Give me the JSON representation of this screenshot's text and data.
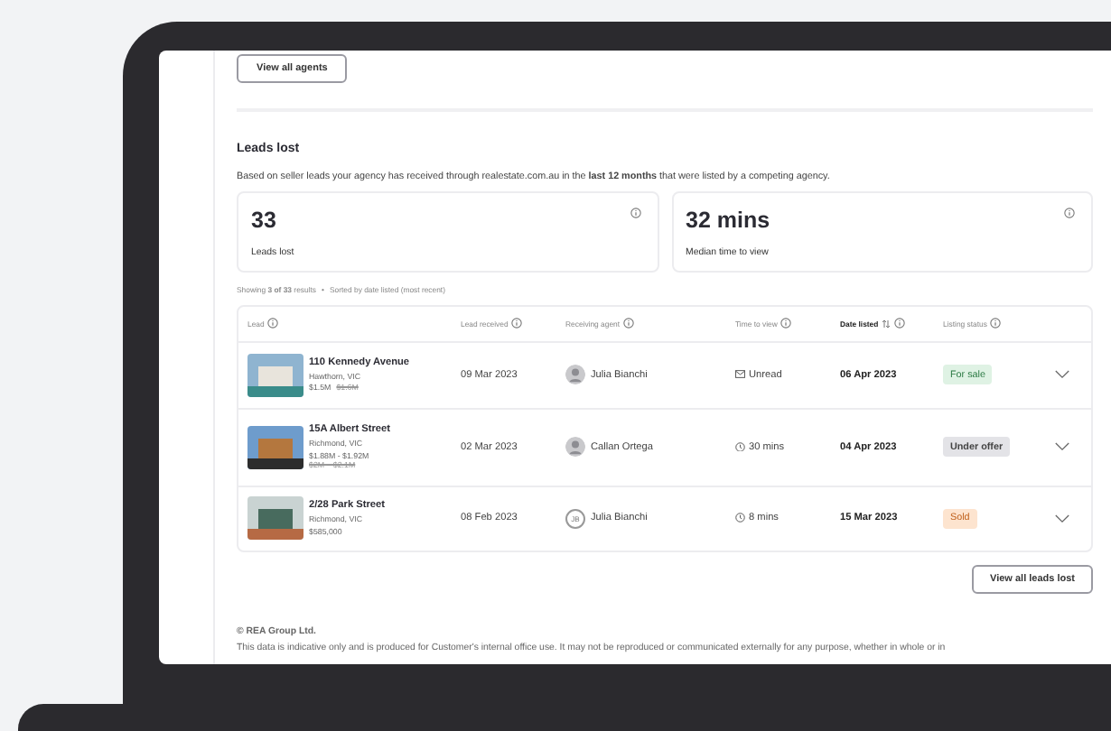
{
  "top_button": "View all agents",
  "section": {
    "title": "Leads lost",
    "description": "Based on seller leads your agency has received through realestate.com.au in the **last 12 months** that were listed by a competing agency.",
    "stats": [
      {
        "value": "33",
        "label": "Leads lost"
      },
      {
        "value": "32 mins",
        "label": "Median time to view"
      }
    ],
    "results_summary": "Showing **3 of 33** results",
    "separator": "•",
    "sort_note": "Sorted by date listed (most recent)",
    "table": {
      "columns": [
        {
          "label": "Lead",
          "sorted": false
        },
        {
          "label": "Lead received",
          "sorted": false
        },
        {
          "label": "Receiving agent",
          "sorted": false
        },
        {
          "label": "Time to view",
          "sorted": false
        },
        {
          "label": "Date listed",
          "sorted": true
        },
        {
          "label": "Listing status",
          "sorted": false
        }
      ],
      "rows": [
        {
          "address": "110 Kennedy Avenue",
          "suburb": "Hawthorn, VIC",
          "prices": [
            {
              "text": "$1.5M",
              "struck": false
            },
            {
              "text": "$1.6M",
              "struck": true
            }
          ],
          "lead_received": "09 Mar 2023",
          "agent": {
            "name": "Julia Bianchi"
          },
          "time_to_view": {
            "kind": "unread",
            "text": "Unread"
          },
          "date_listed": "06 Apr 2023",
          "status": {
            "label": "For sale",
            "kind": "for-sale"
          }
        },
        {
          "address": "15A Albert Street",
          "suburb": "Richmond, VIC",
          "prices": [
            {
              "text": "$1.88M - $1.92M",
              "struck": false
            },
            {
              "text": "$2M – $2.1M",
              "struck": true
            }
          ],
          "lead_received": "02 Mar 2023",
          "agent": {
            "name": "Callan Ortega"
          },
          "time_to_view": {
            "kind": "clock",
            "text": "30 mins"
          },
          "date_listed": "04 Apr 2023",
          "status": {
            "label": "Under offer",
            "kind": "under-offer"
          }
        },
        {
          "address": "2/28 Park Street",
          "suburb": "Richmond, VIC",
          "prices": [
            {
              "text": "$585,000",
              "struck": false
            }
          ],
          "lead_received": "08 Feb 2023",
          "agent": {
            "name": "Julia Bianchi",
            "initials": "JB"
          },
          "time_to_view": {
            "kind": "clock",
            "text": "8 mins"
          },
          "date_listed": "15 Mar 2023",
          "status": {
            "label": "Sold",
            "kind": "sold"
          }
        }
      ]
    },
    "bottom_button": "View all leads lost"
  },
  "footer": {
    "copyright": "© REA Group Ltd.",
    "disclaimer": "This data is indicative only and is produced for Customer's internal office use. It may not be reproduced or communicated externally for any purpose, whether in whole or in"
  }
}
